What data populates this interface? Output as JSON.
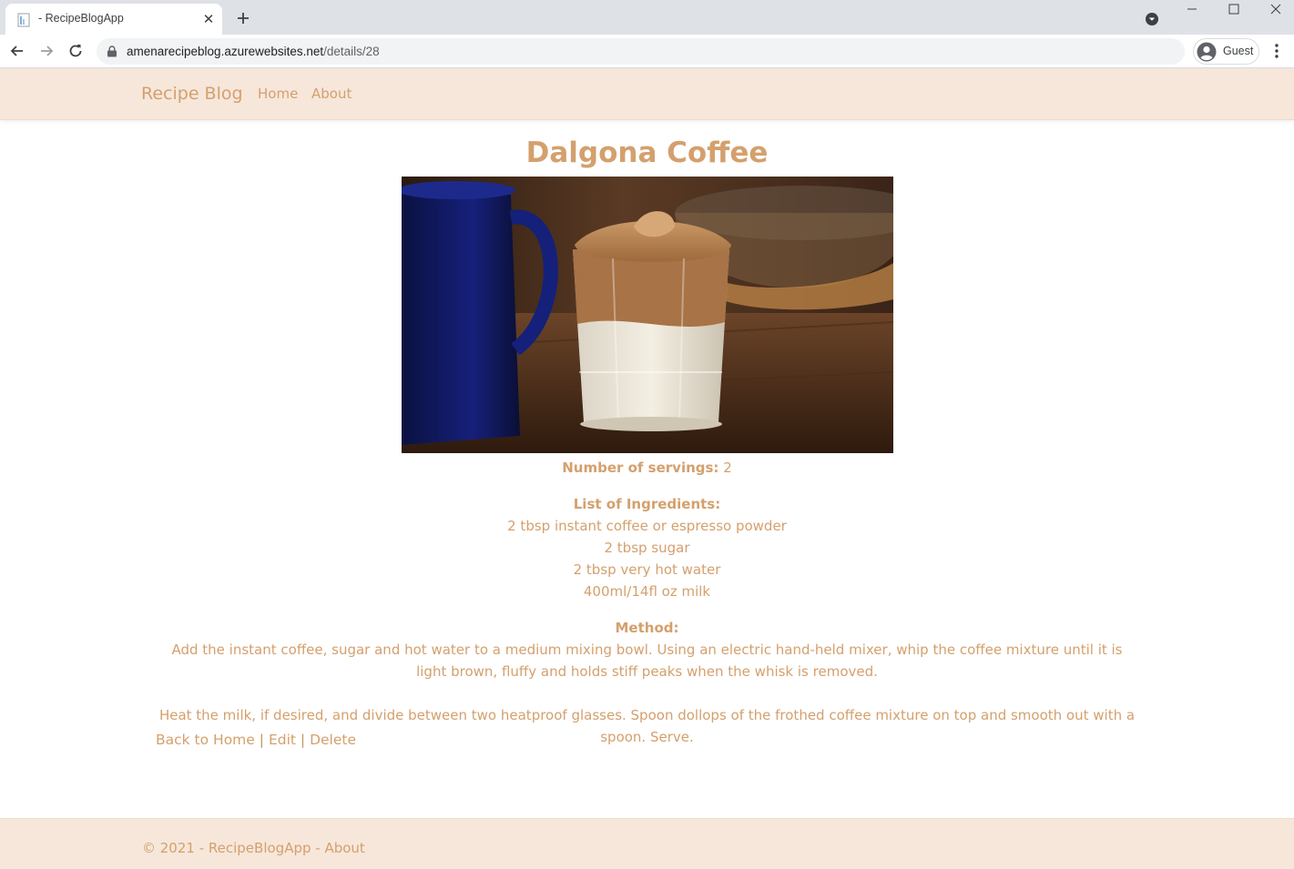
{
  "browser": {
    "tab_title": "- RecipeBlogApp",
    "url_host": "amenarecipeblog.azurewebsites.net",
    "url_path": "/details/28",
    "profile_label": "Guest",
    "icons": [
      "favicon-icon",
      "close-icon",
      "plus-icon",
      "tab-search-icon",
      "minimize-icon",
      "maximize-icon",
      "window-close-icon",
      "back-arrow-icon",
      "forward-arrow-icon",
      "reload-icon",
      "lock-icon",
      "avatar-icon",
      "more-vert-icon"
    ]
  },
  "site": {
    "brand": "Recipe Blog",
    "nav": [
      "Home",
      "About"
    ],
    "accent_color": "#d4a06d",
    "nav_background": "#f6e7da"
  },
  "recipe": {
    "title": "Dalgona Coffee",
    "servings_label": "Number of servings:",
    "servings_value": "2",
    "ingredients_label": "List of Ingredients:",
    "ingredients": [
      "2 tbsp instant coffee or espresso powder",
      "2 tbsp sugar",
      "2 tbsp very hot water",
      "400ml/14fl oz milk"
    ],
    "method_label": "Method:",
    "method": [
      "Add the instant coffee, sugar and hot water to a medium mixing bowl. Using an electric hand-held mixer, whip the coffee mixture until it is light brown, fluffy and holds stiff peaks when the whisk is removed.",
      "Heat the milk, if desired, and divide between two heatproof glasses. Spoon dollops of the frothed coffee mixture on top and smooth out with a spoon. Serve."
    ]
  },
  "actions": {
    "back": "Back to Home",
    "sep1": "|",
    "edit": "Edit",
    "sep2": "|",
    "delete": "Delete"
  },
  "footer": {
    "prefix": "© 2021 - RecipeBlogApp - ",
    "about": "About"
  }
}
